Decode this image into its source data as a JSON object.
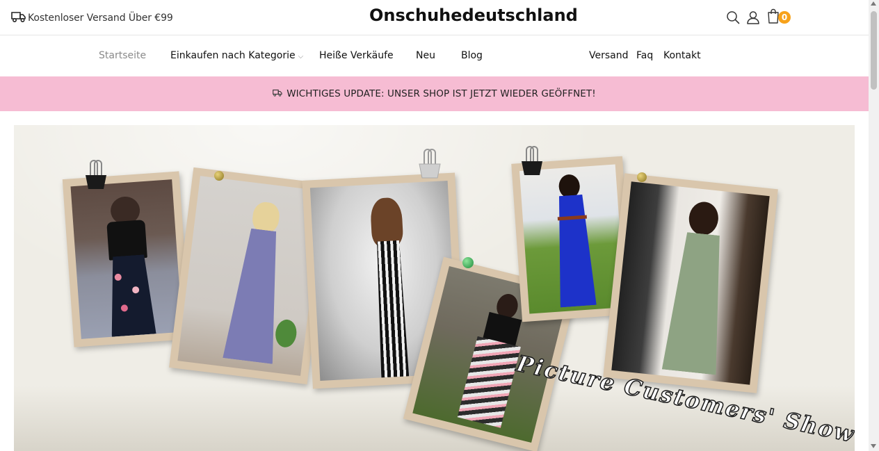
{
  "topbar": {
    "shipping_icon": "truck-icon",
    "shipping_text": "Kostenloser Versand Über €99",
    "brand": "Onschuhedeutschland",
    "search_icon": "search-icon",
    "account_icon": "user-icon",
    "cart_icon": "shopping-bag-icon",
    "cart_count": "0"
  },
  "nav": {
    "items": [
      {
        "label": "Startseite",
        "active": true
      },
      {
        "label": "Einkaufen nach Kategorie",
        "has_dropdown": true
      },
      {
        "label": "Heiße Verkäufe"
      },
      {
        "label": "Neu"
      },
      {
        "label": "Blog"
      },
      {
        "label": "Versand"
      },
      {
        "label": "Faq"
      },
      {
        "label": "Kontakt"
      }
    ]
  },
  "announcement": {
    "icon": "truck-emoji-icon",
    "text": "WICHTIGES UPDATE: UNSER SHOP IST JETZT WIEDER GEÖFFNET!"
  },
  "hero": {
    "caption": "Picture Customers' Show",
    "colors": {
      "background": "#efede6",
      "frame": "#d9c6ac",
      "caption_fill": "#ffffff",
      "caption_stroke": "#1a1a1a"
    }
  },
  "colors": {
    "announcement_bg": "#f6bcd3",
    "cart_badge": "#f7a21b",
    "nav_active": "#8a8a8a"
  }
}
